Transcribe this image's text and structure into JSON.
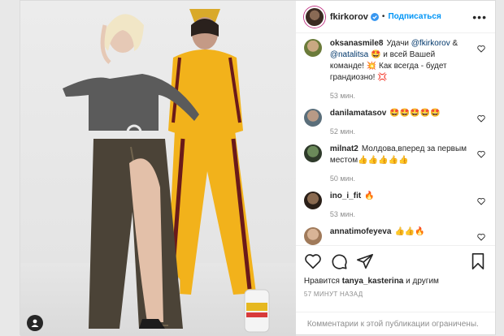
{
  "post": {
    "author": "fkirkorov",
    "follow_label": "Подписаться",
    "separator": "•",
    "more_label": "•••"
  },
  "comments": [
    {
      "user": "oksanasmile8",
      "text_before": "Удачи ",
      "mention1": "@fkirkorov",
      "text_mid": " & ",
      "mention2": "@natalitsa",
      "text_after": " 🤩 и всей Вашей команде! 💥 Как всегда - будет грандиозно! 💢",
      "time": "53 мин."
    },
    {
      "user": "danilamatasov",
      "text": "🤩🤩🤩🤩🤩",
      "time": "52 мин."
    },
    {
      "user": "milnat2",
      "text": "Молдова,вперед за первым местом👍👍👍👍👍",
      "time": "50 мин."
    },
    {
      "user": "ino_i_fit",
      "text": "🔥",
      "time": "53 мин."
    },
    {
      "user": "annatimofeyeva",
      "text": "👍👍🔥",
      "time": ""
    }
  ],
  "likes": {
    "prefix": "Нравится",
    "user": "tanya_kasterina",
    "suffix": "и другим"
  },
  "posted_ago": "57 МИНУТ НАЗАД",
  "comments_restricted": "Комментарии к этой публикации ограничены."
}
